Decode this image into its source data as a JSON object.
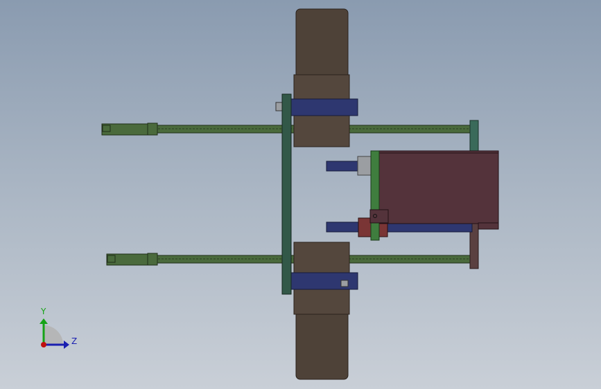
{
  "triad": {
    "y_label": "Y",
    "z_label": "Z",
    "y_color": "#16a316",
    "z_color": "#1a1fb0",
    "x_color": "#c01010"
  },
  "colors": {
    "wheel": "#4e4238",
    "hub": "#54473d",
    "axle": "#2e3770",
    "frame_plate": "#325848",
    "rod": "#4a6a3c",
    "motor_body": "#54333b",
    "motor_flange": "#3f7d3e",
    "coupler_red": "#7a3535",
    "coupler_grey": "#9b9ea2",
    "end_post": "#3a6a5a"
  }
}
